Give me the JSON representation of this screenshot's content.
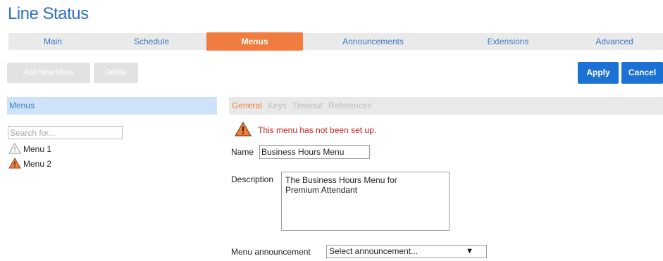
{
  "page": {
    "title": "Line Status"
  },
  "tabs": [
    {
      "label": "Main",
      "active": false
    },
    {
      "label": "Schedule",
      "active": false
    },
    {
      "label": "Menus",
      "active": true
    },
    {
      "label": "Announcements",
      "active": false
    },
    {
      "label": "Extensions",
      "active": false
    },
    {
      "label": "Advanced",
      "active": false
    }
  ],
  "toolbar": {
    "add_new_menu_label": "Add New Menu",
    "delete_label": "Delete",
    "apply_label": "Apply",
    "cancel_label": "Cancel"
  },
  "sidebar": {
    "header": "Menus",
    "search_placeholder": "Search for...",
    "items": [
      {
        "label": "Menu 1",
        "icon": "warning-outline-icon"
      },
      {
        "label": "Menu 2",
        "icon": "warning-filled-icon"
      }
    ]
  },
  "detail": {
    "subtabs": [
      {
        "label": "General",
        "active": true
      },
      {
        "label": "Keys",
        "active": false
      },
      {
        "label": "Timeout",
        "active": false
      },
      {
        "label": "References",
        "active": false
      }
    ],
    "warning_text": "This menu has not been set up.",
    "name_label": "Name",
    "name_value": "Business Hours Menu",
    "description_label": "Description",
    "description_value": "The Business Hours Menu for\nPremium Attendant",
    "announcement_label": "Menu announcement",
    "announcement_value": "Select announcement..."
  },
  "colors": {
    "accent_orange": "#f07d3f",
    "primary_blue": "#1c72d4",
    "title_blue": "#2f6fc4",
    "warning_red": "#d12020"
  }
}
